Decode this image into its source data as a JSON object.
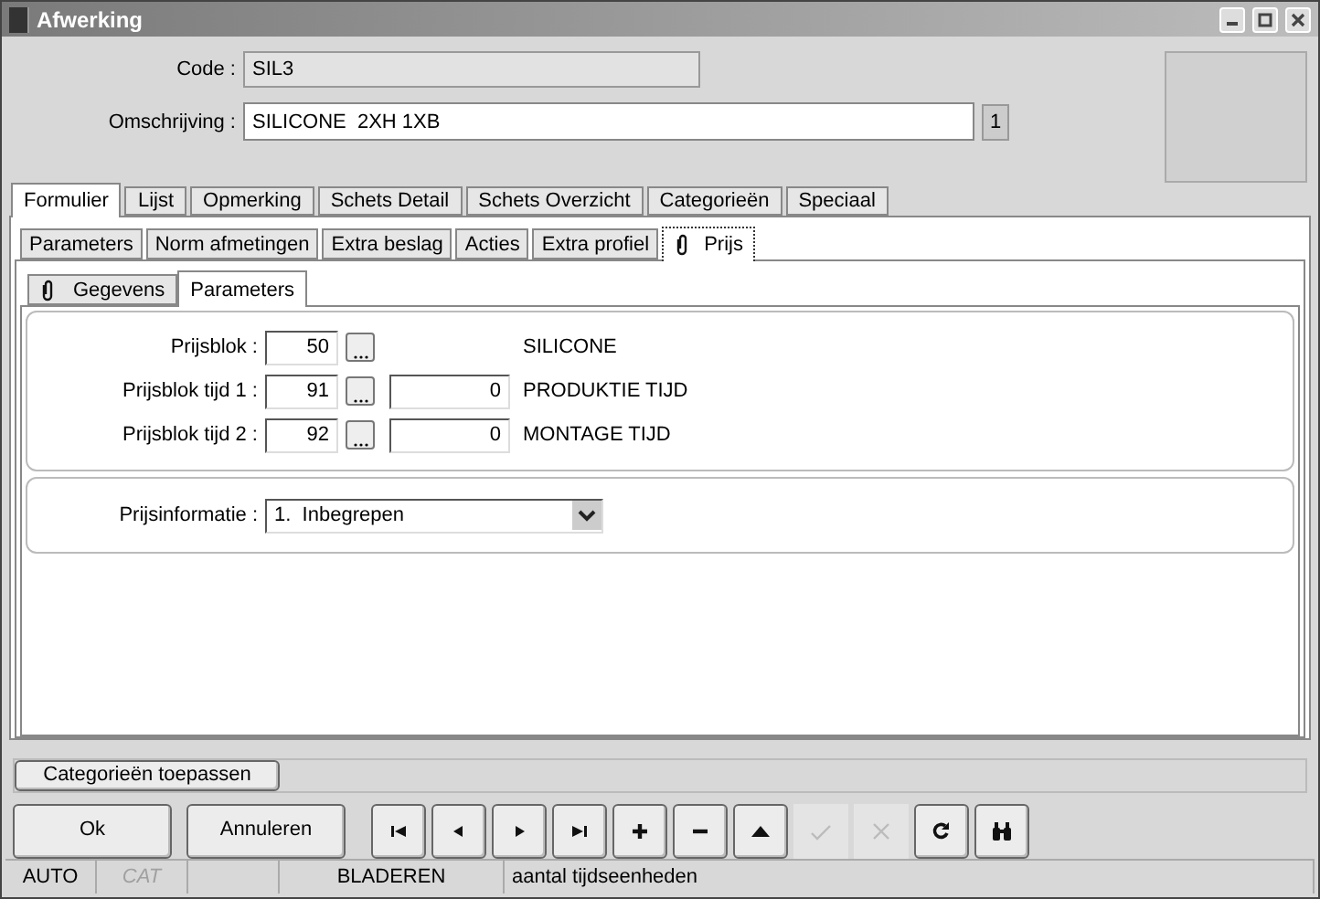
{
  "window": {
    "title": "Afwerking"
  },
  "header": {
    "code": {
      "label": "Code :",
      "value": "SIL3"
    },
    "omschrijving": {
      "label": "Omschrijving :",
      "value": "SILICONE  2XH 1XB",
      "badge": "1"
    }
  },
  "tabs": [
    {
      "label": "Formulier",
      "selected": true
    },
    {
      "label": "Lijst",
      "selected": false
    },
    {
      "label": "Opmerking",
      "selected": false
    },
    {
      "label": "Schets Detail",
      "selected": false
    },
    {
      "label": "Schets Overzicht",
      "selected": false
    },
    {
      "label": "Categorieën",
      "selected": false
    },
    {
      "label": "Speciaal",
      "selected": false
    }
  ],
  "subtabs": [
    {
      "label": "Parameters",
      "selected": false,
      "clip": false
    },
    {
      "label": "Norm afmetingen",
      "selected": false,
      "clip": false
    },
    {
      "label": "Extra beslag",
      "selected": false,
      "clip": false
    },
    {
      "label": "Acties",
      "selected": false,
      "clip": false
    },
    {
      "label": "Extra profiel",
      "selected": false,
      "clip": false
    },
    {
      "label": "Prijs",
      "selected": true,
      "clip": true
    }
  ],
  "inner_tabs": [
    {
      "label": "Gegevens",
      "selected": false,
      "clip": true
    },
    {
      "label": "Parameters",
      "selected": true,
      "clip": false
    }
  ],
  "price_rows": [
    {
      "label": "Prijsblok :",
      "value": "50",
      "time": null,
      "description": "SILICONE"
    },
    {
      "label": "Prijsblok tijd 1 :",
      "value": "91",
      "time": "0",
      "description": "PRODUKTIE TIJD"
    },
    {
      "label": "Prijsblok tijd 2 :",
      "value": "92",
      "time": "0",
      "description": "MONTAGE TIJD"
    }
  ],
  "prijsinformatie": {
    "label": "Prijsinformatie :",
    "value": "1.  Inbegrepen"
  },
  "apply_button": "Categorieën toepassen",
  "buttons": [
    {
      "label": "Ok"
    },
    {
      "label": "Annuleren"
    }
  ],
  "toolbar": [
    {
      "kind": "first",
      "disabled": false
    },
    {
      "kind": "prev",
      "disabled": false
    },
    {
      "kind": "next",
      "disabled": false
    },
    {
      "kind": "last",
      "disabled": false
    },
    {
      "kind": "add",
      "disabled": false
    },
    {
      "kind": "remove",
      "disabled": false
    },
    {
      "kind": "up",
      "disabled": false
    },
    {
      "kind": "confirm",
      "disabled": true
    },
    {
      "kind": "cancel",
      "disabled": true
    },
    {
      "kind": "redo",
      "disabled": false
    },
    {
      "kind": "find",
      "disabled": false
    }
  ],
  "status_bar": [
    {
      "text": "AUTO",
      "disabled": false
    },
    {
      "text": "CAT",
      "disabled": true
    },
    {
      "text": "BLADEREN",
      "disabled": false
    },
    {
      "text": "aantal tijdseenheden",
      "disabled": false
    }
  ]
}
